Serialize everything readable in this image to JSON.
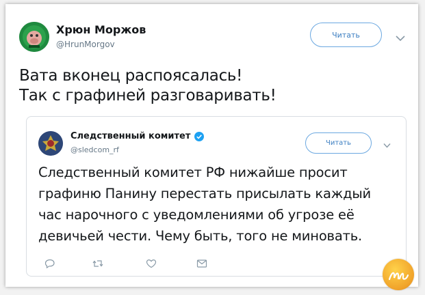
{
  "tweet": {
    "author_name": "Хрюн Моржов",
    "author_handle": "@HrunMorgov",
    "follow_label": "Читать",
    "text": "Вата вконец распоясалась!\nТак с графиней разговаривать!"
  },
  "quoted_tweet": {
    "author_name": "Следственный комитет",
    "author_handle": "@sledcom_rf",
    "follow_label": "Читать",
    "text": "Следственный комитет РФ нижайше просит\nграфиню Панину перестать присылать каждый\nчас нарочного с уведомлениями об угрозе её\nдевичьей чести. Чему быть, того не миновать.",
    "actions": [
      "reply-icon",
      "retweet-icon",
      "like-icon",
      "message-icon"
    ]
  },
  "colors": {
    "follow_border": "#6aa7e0",
    "follow_text": "#3b7ec1",
    "verified": "#1da1f2",
    "watermark": "#f0a22a"
  }
}
